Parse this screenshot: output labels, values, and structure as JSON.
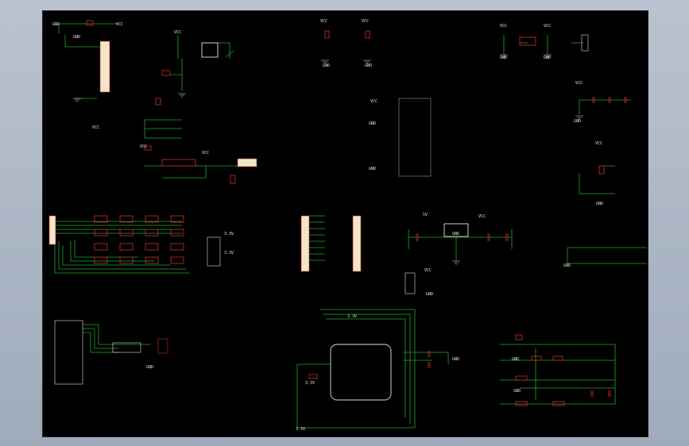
{
  "viewer": {
    "background": "#a7b3c2",
    "canvas_color": "#000000"
  },
  "colors": {
    "wire": "#1fa82a",
    "part": "#c0262a",
    "label": "#4a55ff",
    "header": "#f2e6c8",
    "power": "#e0e0e0"
  },
  "labels": {
    "vcc": "VCC",
    "gnd": "GND",
    "v33": "3.3V",
    "v5": "5V",
    "gnd_box": "GND"
  }
}
